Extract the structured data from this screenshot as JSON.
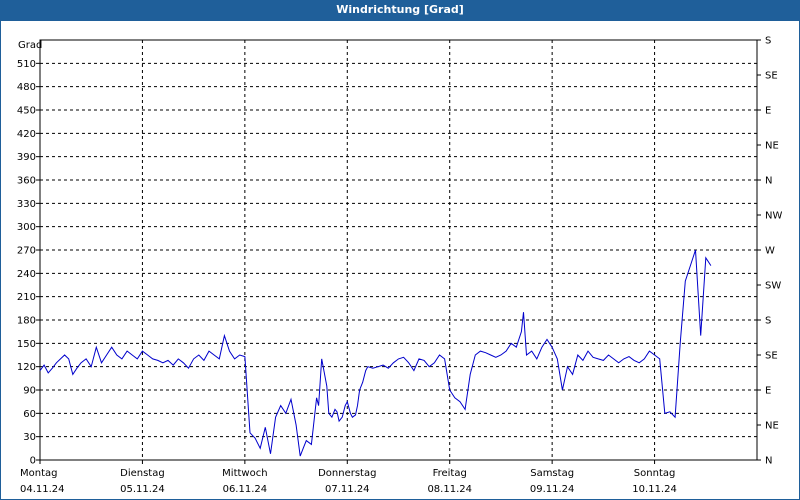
{
  "title": "Windrichtung [Grad]",
  "chart_data": {
    "type": "line",
    "title": "Windrichtung [Grad]",
    "ylabel": "Grad",
    "ylim": [
      0,
      540
    ],
    "y_ticks": [
      0,
      30,
      60,
      90,
      120,
      150,
      180,
      210,
      240,
      270,
      300,
      330,
      360,
      390,
      420,
      450,
      480,
      510
    ],
    "y2_ticks": [
      "N",
      "NE",
      "E",
      "SE",
      "S",
      "SW",
      "W",
      "NW",
      "N",
      "NE",
      "E",
      "SE",
      "S"
    ],
    "x_days": [
      {
        "day": "Montag",
        "date": "04.11.24"
      },
      {
        "day": "Dienstag",
        "date": "05.11.24"
      },
      {
        "day": "Mittwoch",
        "date": "06.11.24"
      },
      {
        "day": "Donnerstag",
        "date": "07.11.24"
      },
      {
        "day": "Freitag",
        "date": "08.11.24"
      },
      {
        "day": "Samstag",
        "date": "09.11.24"
      },
      {
        "day": "Sonntag",
        "date": "10.11.24"
      }
    ],
    "xlim_days": [
      0,
      7
    ],
    "grid": true,
    "color": "#0000cc",
    "series": [
      {
        "days": [
          0,
          0.04,
          0.08,
          0.12,
          0.16,
          0.2,
          0.24,
          0.28,
          0.32,
          0.36,
          0.4,
          0.45,
          0.5,
          0.55,
          0.6,
          0.65,
          0.7,
          0.75,
          0.8,
          0.85,
          0.9,
          0.95,
          1.0,
          1.05,
          1.1,
          1.15,
          1.2,
          1.25,
          1.3,
          1.35,
          1.4,
          1.45,
          1.5,
          1.55,
          1.6,
          1.65,
          1.7,
          1.75,
          1.8,
          1.85,
          1.9,
          1.95,
          2.0,
          2.05,
          2.1,
          2.15,
          2.2,
          2.25,
          2.3,
          2.35,
          2.4,
          2.45,
          2.5,
          2.54,
          2.57,
          2.6,
          2.65,
          2.7,
          2.72,
          2.75,
          2.8,
          2.82,
          2.85,
          2.88,
          2.9,
          2.92,
          2.95,
          2.98,
          3.0,
          3.03,
          3.05,
          3.08,
          3.1,
          3.12,
          3.15,
          3.18,
          3.2,
          3.25,
          3.3,
          3.35,
          3.4,
          3.45,
          3.5,
          3.55,
          3.6,
          3.65,
          3.7,
          3.75,
          3.8,
          3.85,
          3.9,
          3.95,
          4.0,
          4.05,
          4.1,
          4.15,
          4.2,
          4.25,
          4.3,
          4.35,
          4.4,
          4.45,
          4.5,
          4.55,
          4.6,
          4.65,
          4.7,
          4.72,
          4.75,
          4.8,
          4.85,
          4.9,
          4.95,
          5.0,
          5.05,
          5.1,
          5.15,
          5.2,
          5.25,
          5.3,
          5.35,
          5.4,
          5.45,
          5.5,
          5.55,
          5.6,
          5.65,
          5.7,
          5.75,
          5.8,
          5.85,
          5.9,
          5.95,
          6.0,
          6.05,
          6.1,
          6.15,
          6.2,
          6.25,
          6.3,
          6.35,
          6.4,
          6.45,
          6.5,
          6.55,
          6.58,
          6.62,
          6.65,
          6.7,
          6.75,
          6.8,
          6.85,
          6.9,
          6.92,
          6.95,
          6.98
        ],
        "values": [
          115,
          122,
          112,
          118,
          125,
          130,
          135,
          130,
          110,
          118,
          125,
          130,
          120,
          145,
          125,
          135,
          145,
          135,
          130,
          140,
          135,
          130,
          140,
          135,
          130,
          128,
          125,
          128,
          122,
          130,
          125,
          118,
          130,
          135,
          128,
          140,
          135,
          130,
          160,
          140,
          130,
          135,
          133,
          35,
          28,
          15,
          42,
          8,
          55,
          70,
          60,
          78,
          45,
          5,
          15,
          25,
          20,
          80,
          70,
          130,
          95,
          60,
          55,
          65,
          62,
          50,
          55,
          70,
          75,
          60,
          55,
          58,
          70,
          90,
          100,
          115,
          120,
          118,
          120,
          122,
          118,
          125,
          130,
          132,
          125,
          115,
          130,
          128,
          120,
          125,
          135,
          130,
          90,
          80,
          75,
          65,
          110,
          135,
          140,
          138,
          135,
          132,
          135,
          140,
          150,
          145,
          165,
          190,
          135,
          140,
          130,
          145,
          155,
          145,
          130,
          90,
          120,
          110,
          135,
          128,
          140,
          132,
          130,
          128,
          135,
          130,
          125,
          130,
          133,
          128,
          125,
          130,
          140,
          135,
          130,
          60,
          62,
          55,
          150,
          230,
          250,
          270,
          160,
          260,
          250
        ]
      }
    ]
  }
}
